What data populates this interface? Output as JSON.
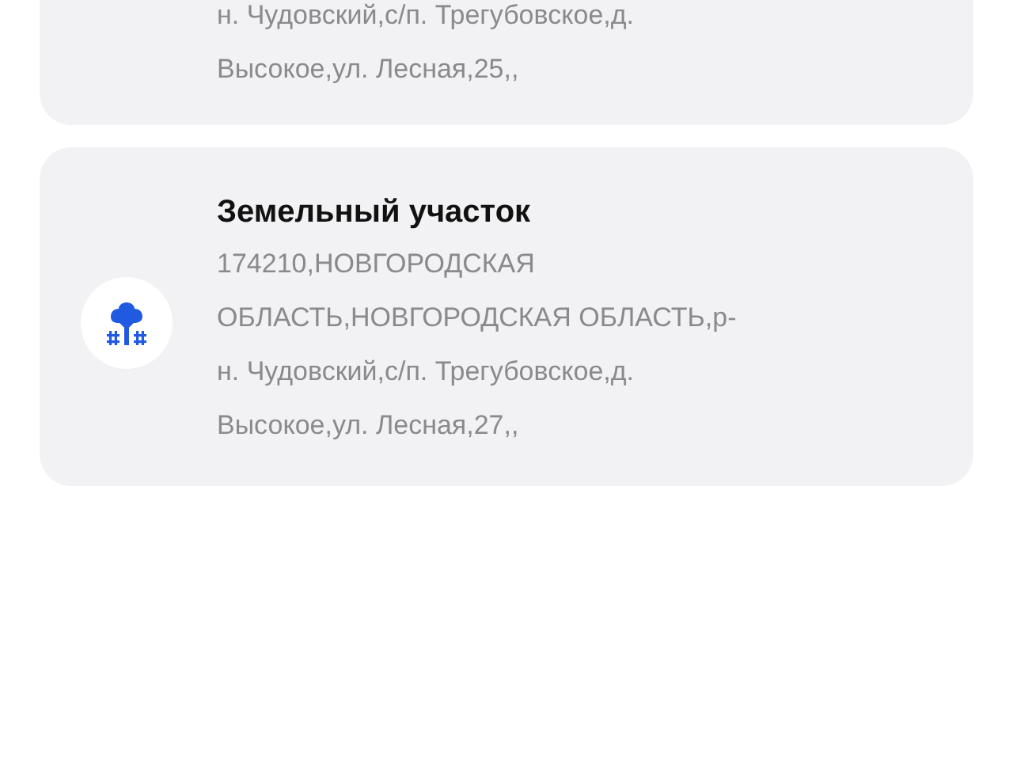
{
  "cards": [
    {
      "kind": "cut",
      "address_lines": [
        "н. Чудовский,с/п. Трегубовское,д.",
        "Высокое,ул. Лесная,25,,"
      ]
    },
    {
      "kind": "full",
      "title": "Земельный участок",
      "address_lines": [
        "174210,НОВГОРОДСКАЯ",
        "ОБЛАСТЬ,НОВГОРОДСКАЯ ОБЛАСТЬ,р-",
        "н. Чудовский,с/п. Трегубовское,д.",
        "Высокое,ул. Лесная,27,,"
      ]
    }
  ]
}
